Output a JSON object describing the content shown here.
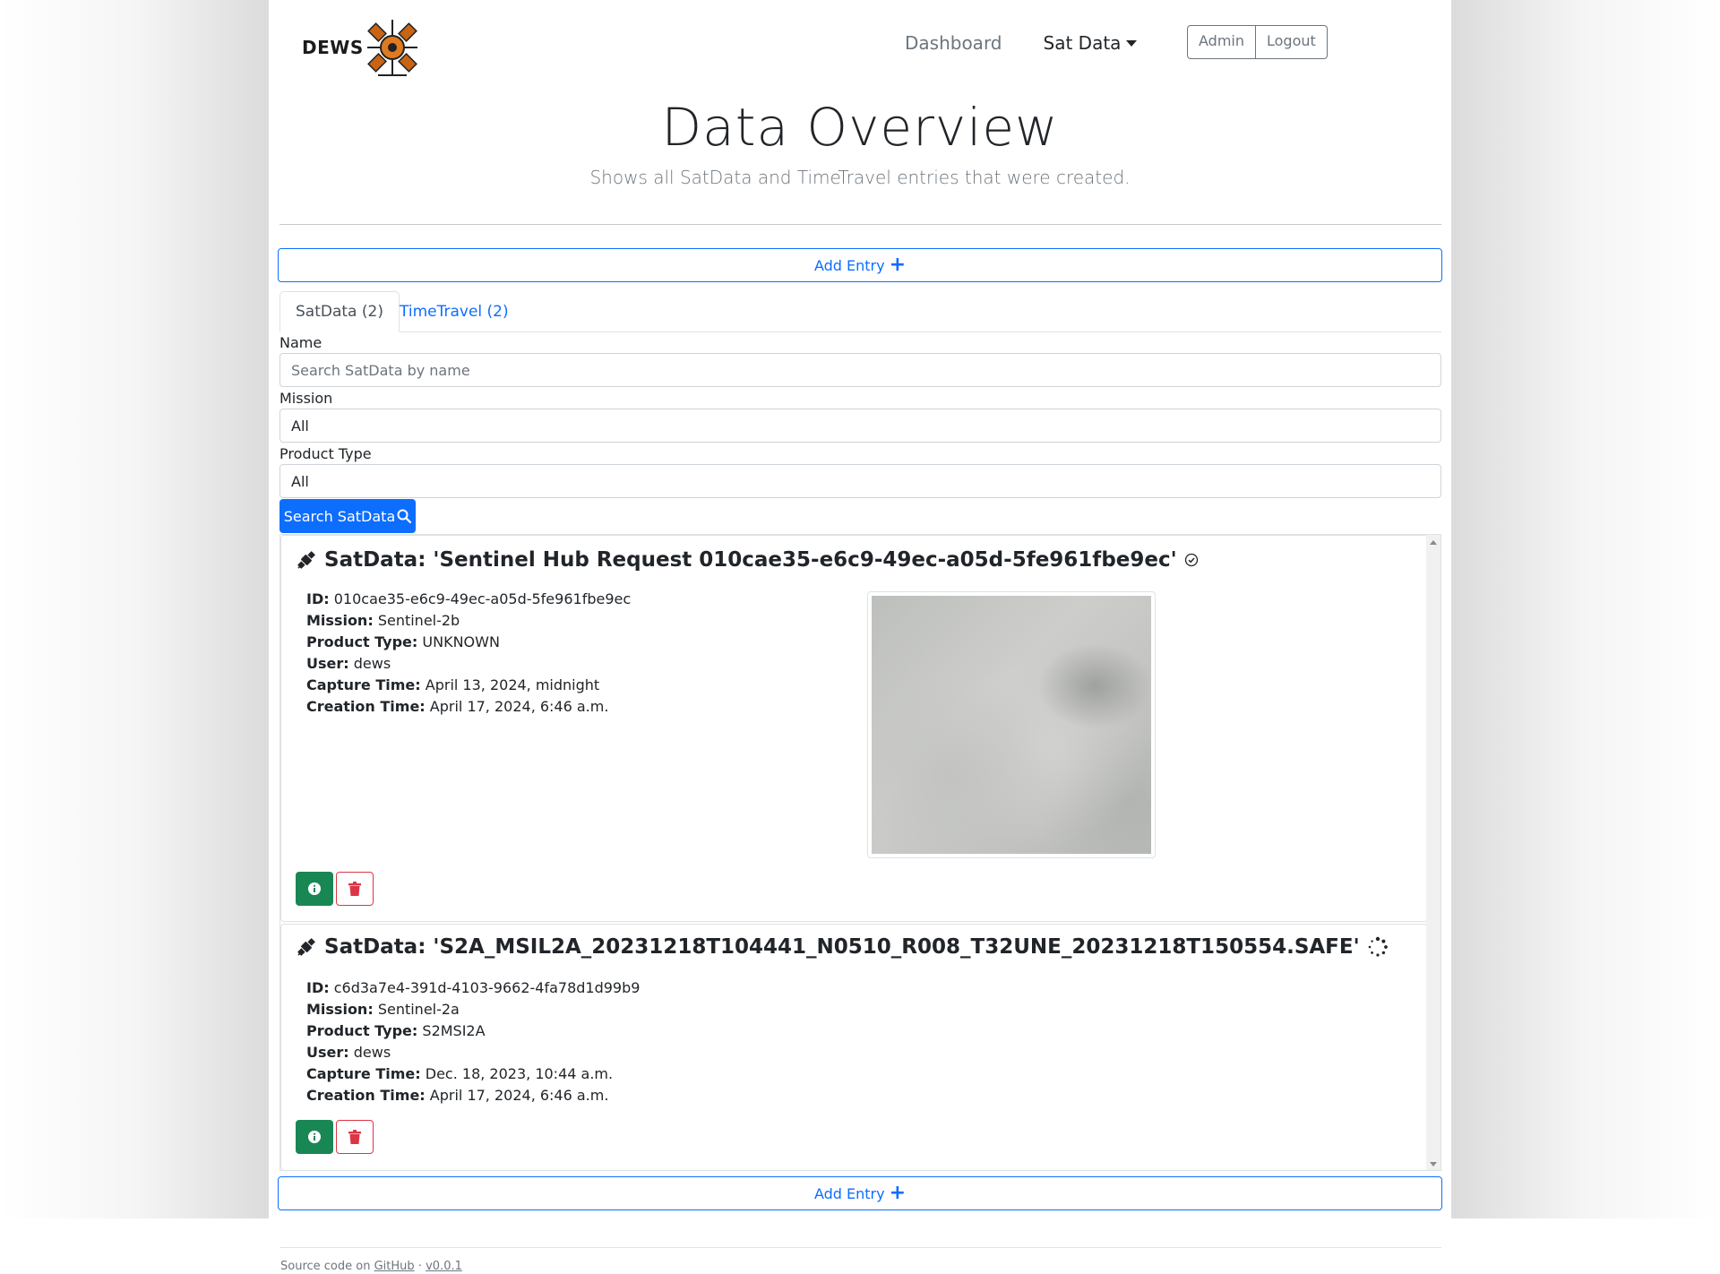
{
  "header": {
    "logo_text": "DEWS",
    "nav": {
      "dashboard": "Dashboard",
      "sat_data": "Sat Data"
    },
    "admin_label": "Admin",
    "logout_label": "Logout"
  },
  "page": {
    "title": "Data Overview",
    "subtitle": "Shows all SatData and TimeTravel entries that were created.",
    "add_entry_label": "Add Entry"
  },
  "tabs": [
    {
      "label": "SatData (2)",
      "active": true
    },
    {
      "label": "TimeTravel (2)",
      "active": false
    }
  ],
  "filters": {
    "name_label": "Name",
    "name_placeholder": "Search SatData by name",
    "mission_label": "Mission",
    "mission_value": "All",
    "product_type_label": "Product Type",
    "product_type_value": "All",
    "search_label": "Search SatData"
  },
  "entries": [
    {
      "title": "SatData: 'Sentinel Hub Request 010cae35-e6c9-49ec-a05d-5fe961fbe9ec'",
      "status_icon": "check-circle-icon",
      "id_label": "ID:",
      "id": "010cae35-e6c9-49ec-a05d-5fe961fbe9ec",
      "mission_label": "Mission:",
      "mission": "Sentinel-2b",
      "product_type_label": "Product Type:",
      "product_type": "UNKNOWN",
      "user_label": "User:",
      "user": "dews",
      "capture_time_label": "Capture Time:",
      "capture_time": "April 13, 2024, midnight",
      "creation_time_label": "Creation Time:",
      "creation_time": "April 17, 2024, 6:46 a.m.",
      "has_thumbnail": true
    },
    {
      "title": "SatData: 'S2A_MSIL2A_20231218T104441_N0510_R008_T32UNE_20231218T150554.SAFE'",
      "status_icon": "loading-spinner-icon",
      "id_label": "ID:",
      "id": "c6d3a7e4-391d-4103-9662-4fa78d1d99b9",
      "mission_label": "Mission:",
      "mission": "Sentinel-2a",
      "product_type_label": "Product Type:",
      "product_type": "S2MSI2A",
      "user_label": "User:",
      "user": "dews",
      "capture_time_label": "Capture Time:",
      "capture_time": "Dec. 18, 2023, 10:44 a.m.",
      "creation_time_label": "Creation Time:",
      "creation_time": "April 17, 2024, 6:46 a.m.",
      "has_thumbnail": false
    }
  ],
  "footer": {
    "prefix": "Source code on",
    "github_label": "GitHub",
    "separator": "·",
    "version": "v0.0.1"
  },
  "colors": {
    "primary": "#0d6efd",
    "success": "#198754",
    "danger": "#dc3545",
    "muted": "#6c757d"
  }
}
